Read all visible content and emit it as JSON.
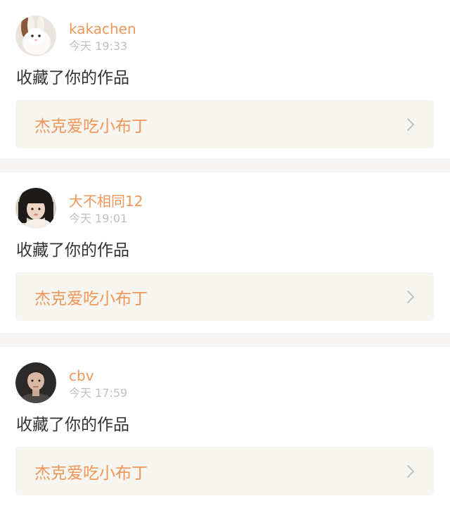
{
  "colors": {
    "accent": "#f0965a",
    "timestamp": "#c0c0c0",
    "body_text": "#333333",
    "card_bg": "#f6f5ef",
    "separator": "#f5f4f2"
  },
  "icons": {
    "card_arrow": "chevron-right-icon"
  },
  "notifications": [
    {
      "username": "kakachen",
      "time": "今天 19:33",
      "action": "收藏了你的作品",
      "work_title": "杰克爱吃小布丁"
    },
    {
      "username": "大不相同12",
      "time": "今天 19:01",
      "action": "收藏了你的作品",
      "work_title": "杰克爱吃小布丁"
    },
    {
      "username": "cbv",
      "time": "今天 17:59",
      "action": "收藏了你的作品",
      "work_title": "杰克爱吃小布丁"
    }
  ]
}
